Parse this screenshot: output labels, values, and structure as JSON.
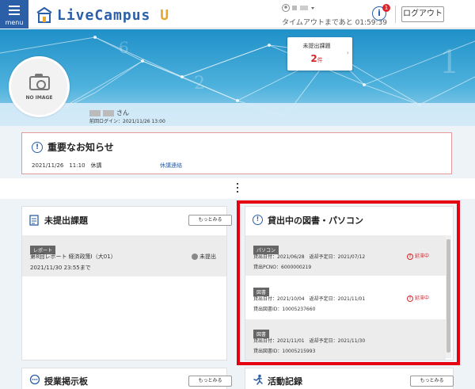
{
  "header": {
    "menu_label": "menu",
    "logo_text_main": "LiveCampus",
    "logo_text_accent": "U",
    "timeout_text": "タイムアウトまであと 01:59:39",
    "info_badge": "1",
    "logout_label": "ログアウト"
  },
  "profile": {
    "no_image_label": "NO IMAGE",
    "name_suffix": "さん",
    "last_login": "前回ログイン：2021/11/26 13:00"
  },
  "unsubmitted_summary": {
    "title": "未提出課題",
    "count": "2",
    "unit": "件"
  },
  "notice": {
    "title": "重要なお知らせ",
    "date": "2021/11/26　11:10　休講",
    "link": "休講連絡"
  },
  "assignments": {
    "title": "未提出課題",
    "more_label": "もっとみる",
    "items": [
      {
        "tag": "レポート",
        "name": "第8回レポート 経済政策Ⅰ（大01）",
        "status": "未提出",
        "deadline": "2021/11/30 23:55まで"
      }
    ]
  },
  "loans": {
    "title": "貸出中の図書・パソコン",
    "items": [
      {
        "tag": "パソコン",
        "line1": "貸出日付：2021/06/28　返却予定日：2021/07/12",
        "line2": "貸出PCNO：6000000219",
        "status": "延滞中"
      },
      {
        "tag": "図書",
        "line1": "貸出日付：2021/10/04　返却予定日：2021/11/01",
        "line2": "貸出図書ID：10005237660",
        "status": "延滞中"
      },
      {
        "tag": "図書",
        "line1": "貸出日付：2021/11/01　返却予定日：2021/11/30",
        "line2": "貸出図書ID：10005215993",
        "status": ""
      }
    ]
  },
  "bulletin": {
    "title": "授業掲示板",
    "more_label": "もっとみる"
  },
  "activity": {
    "title": "活動記録",
    "more_label": "もっとみる"
  }
}
